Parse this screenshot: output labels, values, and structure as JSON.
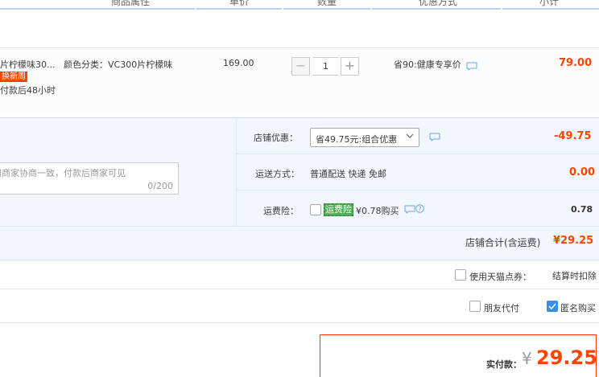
{
  "table_header": {
    "product_attr": "商品属性",
    "unit_price": "单价",
    "quantity": "数量",
    "discount": "优惠方式",
    "subtotal": "小计"
  },
  "product": {
    "title": "片柠檬味30...",
    "attr": "颜色分类：VC300片柠檬味",
    "new_tag": "换新周",
    "ship_note": "付款后48小时",
    "price": "169.00",
    "qty": "1",
    "qty_minus": "−",
    "qty_plus": "+",
    "discount": "省90:健康专享价",
    "subtotal": "79.00"
  },
  "shop": {
    "memo_placeholder": "和商家协商一致，付款后商家可见",
    "memo_counter": "0/200",
    "coupon_label": "店铺优惠：",
    "coupon_value": "省49.75元:组合优惠",
    "coupon_amount": "-49.75",
    "delivery_label": "运送方式：",
    "delivery_value": "普通配送 快递 免邮",
    "delivery_amount": "0.00",
    "insurance_label": "运费险：",
    "insurance_tag": "运费险",
    "insurance_value": "¥0.78购买",
    "insurance_amount": "0.78",
    "total_label": "店铺合计(含运费)",
    "total_value": "¥29.25"
  },
  "options": {
    "tmall_points_label": "使用天猫点券：",
    "tmall_points_note": "结算时扣除",
    "friend_pay_label": "朋友代付",
    "anonymous_label": "匿名购买",
    "anonymous_checked": true
  },
  "payment": {
    "label": "实付款：",
    "currency": "¥",
    "amount": "29.25"
  },
  "colors": {
    "accent_red": "#ff4400",
    "header_blue": "#b2d1ff",
    "shop_bg": "#f2f7ff",
    "checkbox_blue": "#3a8ee6"
  }
}
